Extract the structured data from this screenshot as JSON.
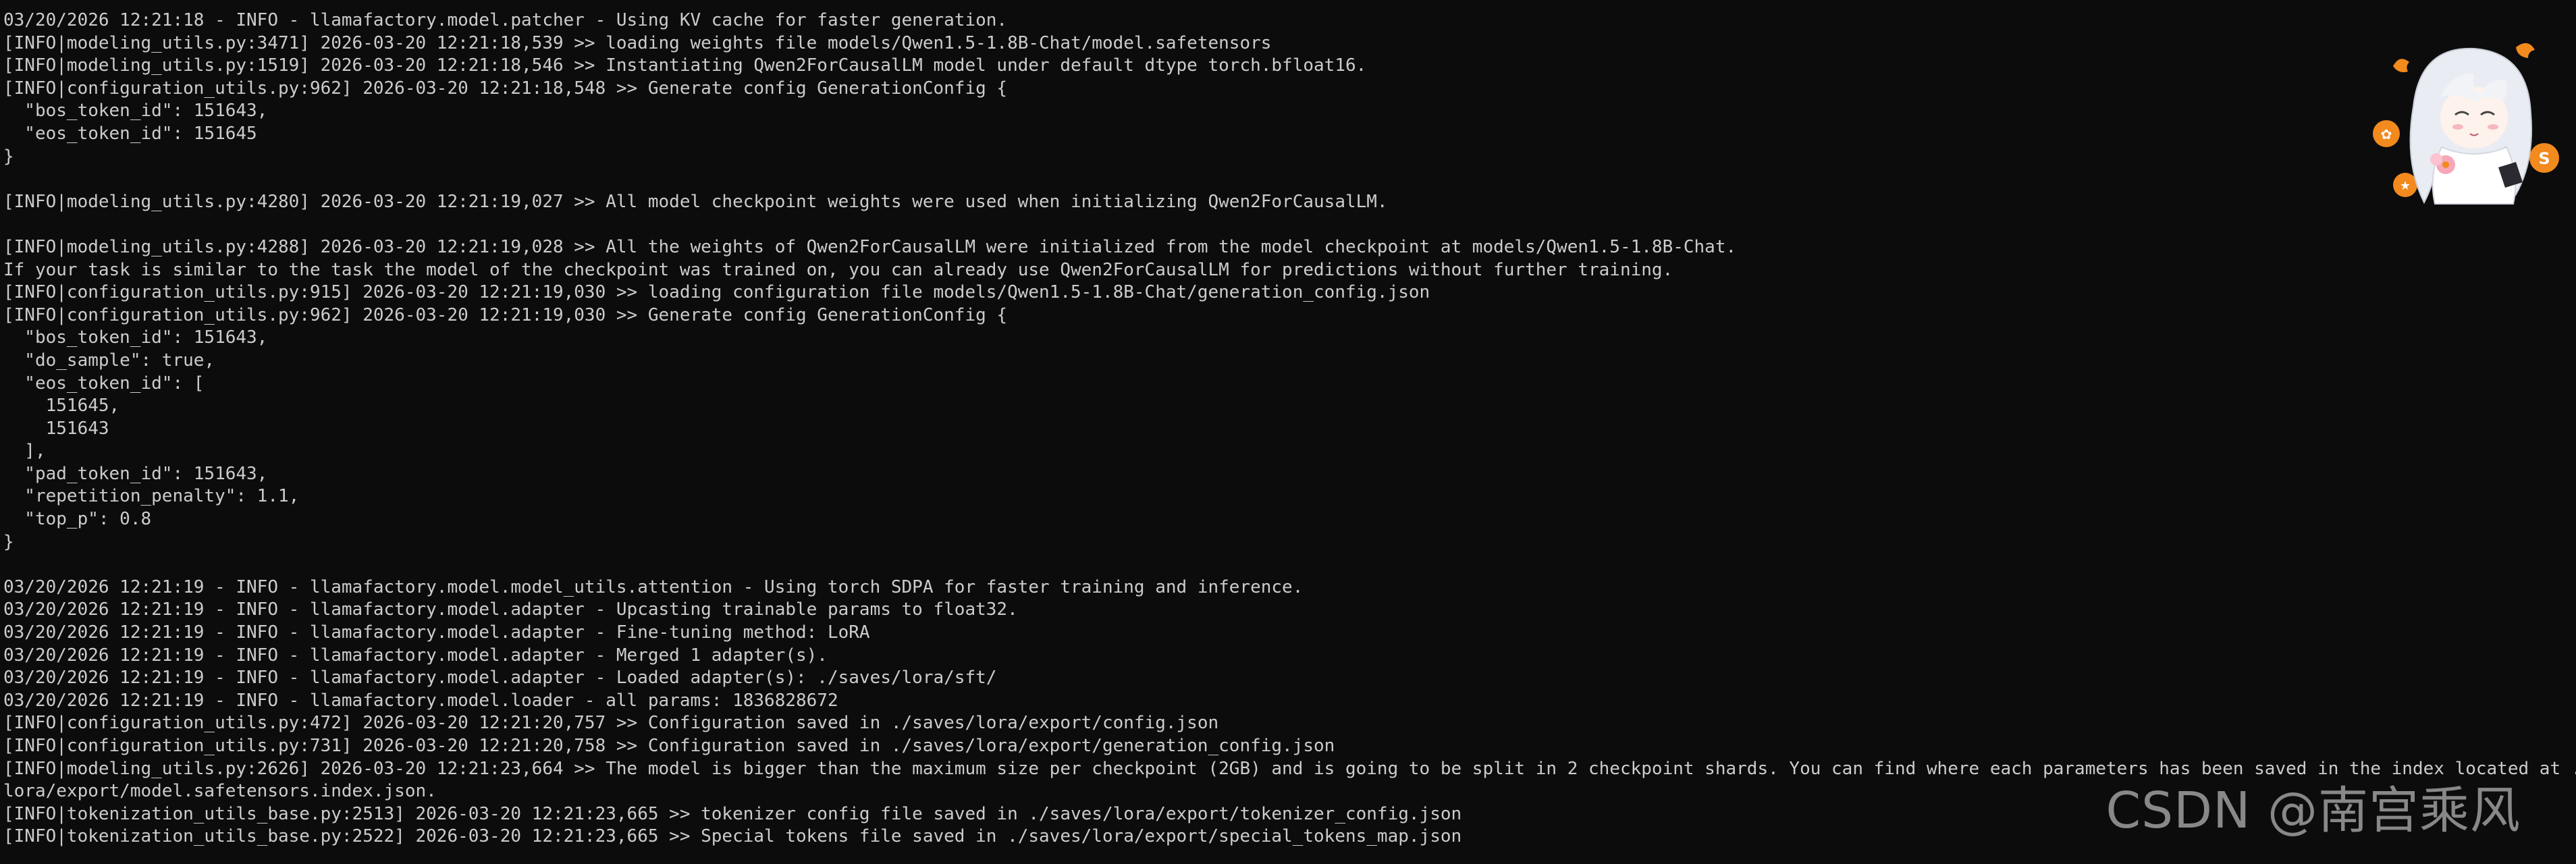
{
  "terminal": {
    "lines": [
      "03/20/2026 12:21:18 - INFO - llamafactory.model.patcher - Using KV cache for faster generation.",
      "[INFO|modeling_utils.py:3471] 2026-03-20 12:21:18,539 >> loading weights file models/Qwen1.5-1.8B-Chat/model.safetensors",
      "[INFO|modeling_utils.py:1519] 2026-03-20 12:21:18,546 >> Instantiating Qwen2ForCausalLM model under default dtype torch.bfloat16.",
      "[INFO|configuration_utils.py:962] 2026-03-20 12:21:18,548 >> Generate config GenerationConfig {",
      "  \"bos_token_id\": 151643,",
      "  \"eos_token_id\": 151645",
      "}",
      "",
      "[INFO|modeling_utils.py:4280] 2026-03-20 12:21:19,027 >> All model checkpoint weights were used when initializing Qwen2ForCausalLM.",
      "",
      "[INFO|modeling_utils.py:4288] 2026-03-20 12:21:19,028 >> All the weights of Qwen2ForCausalLM were initialized from the model checkpoint at models/Qwen1.5-1.8B-Chat.",
      "If your task is similar to the task the model of the checkpoint was trained on, you can already use Qwen2ForCausalLM for predictions without further training.",
      "[INFO|configuration_utils.py:915] 2026-03-20 12:21:19,030 >> loading configuration file models/Qwen1.5-1.8B-Chat/generation_config.json",
      "[INFO|configuration_utils.py:962] 2026-03-20 12:21:19,030 >> Generate config GenerationConfig {",
      "  \"bos_token_id\": 151643,",
      "  \"do_sample\": true,",
      "  \"eos_token_id\": [",
      "    151645,",
      "    151643",
      "  ],",
      "  \"pad_token_id\": 151643,",
      "  \"repetition_penalty\": 1.1,",
      "  \"top_p\": 0.8",
      "}",
      "",
      "03/20/2026 12:21:19 - INFO - llamafactory.model.model_utils.attention - Using torch SDPA for faster training and inference.",
      "03/20/2026 12:21:19 - INFO - llamafactory.model.adapter - Upcasting trainable params to float32.",
      "03/20/2026 12:21:19 - INFO - llamafactory.model.adapter - Fine-tuning method: LoRA",
      "03/20/2026 12:21:19 - INFO - llamafactory.model.adapter - Merged 1 adapter(s).",
      "03/20/2026 12:21:19 - INFO - llamafactory.model.adapter - Loaded adapter(s): ./saves/lora/sft/",
      "03/20/2026 12:21:19 - INFO - llamafactory.model.loader - all params: 1836828672",
      "[INFO|configuration_utils.py:472] 2026-03-20 12:21:20,757 >> Configuration saved in ./saves/lora/export/config.json",
      "[INFO|configuration_utils.py:731] 2026-03-20 12:21:20,758 >> Configuration saved in ./saves/lora/export/generation_config.json",
      "[INFO|modeling_utils.py:2626] 2026-03-20 12:21:23,664 >> The model is bigger than the maximum size per checkpoint (2GB) and is going to be split in 2 checkpoint shards. You can find where each parameters has been saved in the index located at ./saves/",
      "lora/export/model.safetensors.index.json.",
      "[INFO|tokenization_utils_base.py:2513] 2026-03-20 12:21:23,665 >> tokenizer config file saved in ./saves/lora/export/tokenizer_config.json",
      "[INFO|tokenization_utils_base.py:2522] 2026-03-20 12:21:23,665 >> Special tokens file saved in ./saves/lora/export/special_tokens_map.json"
    ]
  },
  "watermark": {
    "text": "CSDN @南宫乘风"
  },
  "colors": {
    "background": "#0c0c0c",
    "foreground": "#cccccc",
    "mascot_accent": "#f28a1e"
  }
}
